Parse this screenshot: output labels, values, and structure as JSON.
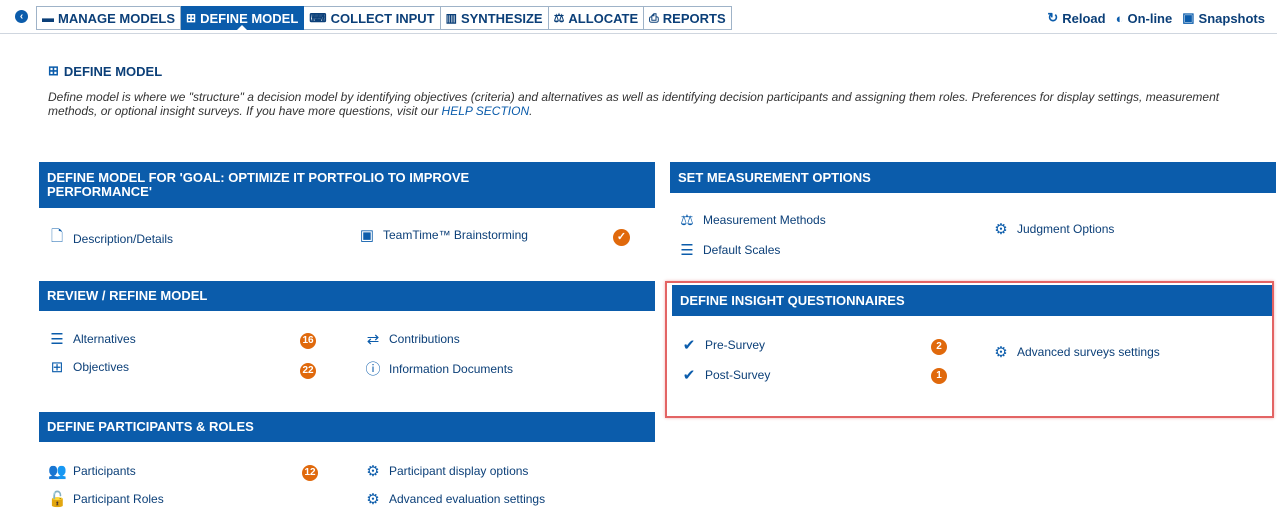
{
  "topbar": {
    "back_icon": "back-arrow-icon",
    "tabs": [
      {
        "label": "MANAGE MODELS",
        "icon": "folder-icon"
      },
      {
        "label": "DEFINE MODEL",
        "icon": "hierarchy-icon",
        "active": true
      },
      {
        "label": "COLLECT INPUT",
        "icon": "keyboard-icon"
      },
      {
        "label": "SYNTHESIZE",
        "icon": "chart-icon"
      },
      {
        "label": "ALLOCATE",
        "icon": "balance-icon"
      },
      {
        "label": "REPORTS",
        "icon": "print-icon"
      }
    ],
    "tools": {
      "reload": "Reload",
      "online": "On-line",
      "snapshots": "Snapshots"
    }
  },
  "page": {
    "title": "DEFINE MODEL",
    "intro_text": "Define model is where we \"structure\" a decision model by identifying objectives (criteria) and alternatives as well as identifying decision participants and assigning them roles. Preferences for display settings, measurement methods, or optional insight surveys. If you have more questions, visit our ",
    "help_link": "HELP SECTION",
    "intro_end": "."
  },
  "panels": {
    "define_model": {
      "title": "DEFINE MODEL FOR 'GOAL: OPTIMIZE IT PORTFOLIO TO IMPROVE PERFORMANCE'",
      "description": "Description/Details",
      "brainstorming": "TeamTime™ Brainstorming"
    },
    "review": {
      "title": "REVIEW / REFINE MODEL",
      "alternatives": "Alternatives",
      "alternatives_count": "16",
      "objectives": "Objectives",
      "objectives_count": "22",
      "contributions": "Contributions",
      "information_documents": "Information Documents"
    },
    "participants": {
      "title": "DEFINE PARTICIPANTS & ROLES",
      "participants": "Participants",
      "participants_count": "12",
      "roles": "Participant Roles",
      "display_options": "Participant display options",
      "advanced_evaluation": "Advanced evaluation settings"
    },
    "measurement": {
      "title": "SET MEASUREMENT OPTIONS",
      "methods": "Measurement Methods",
      "scales": "Default Scales",
      "judgment": "Judgment Options"
    },
    "insight": {
      "title": "DEFINE INSIGHT QUESTIONNAIRES",
      "pre_survey": "Pre-Survey",
      "pre_count": "2",
      "post_survey": "Post-Survey",
      "post_count": "1",
      "advanced": "Advanced surveys settings"
    }
  },
  "colors": {
    "accent": "#0b5cab",
    "badge": "#e0690c",
    "highlight": "#e36464"
  }
}
